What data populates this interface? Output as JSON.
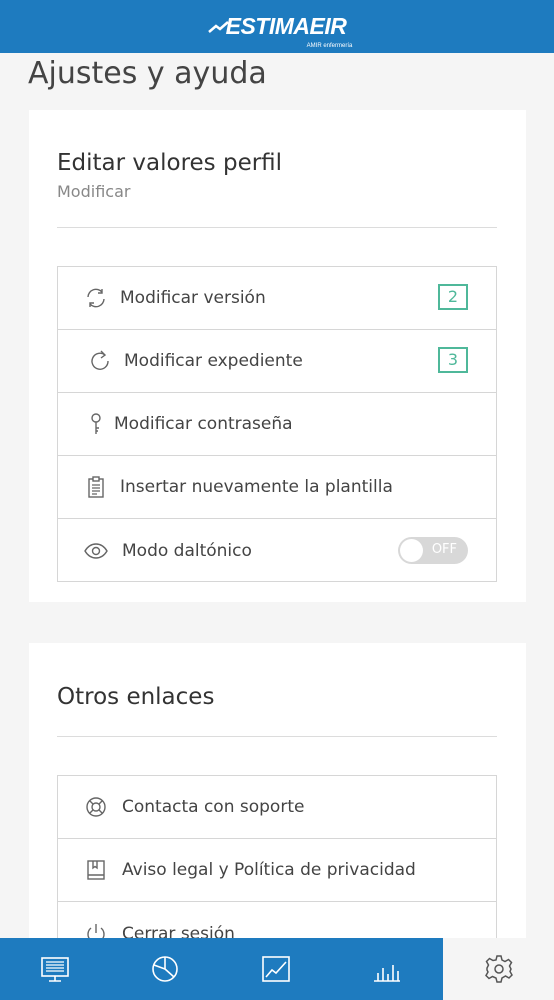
{
  "header": {
    "logo_text": "ESTIMAEIR",
    "logo_sub": "AMIR enfermería"
  },
  "page_title": "Ajustes y ayuda",
  "profile_card": {
    "title": "Editar valores perfil",
    "subtitle": "Modificar",
    "items": [
      {
        "label": "Modificar versión",
        "icon": "refresh-icon",
        "badge": "2"
      },
      {
        "label": "Modificar expediente",
        "icon": "redo-icon",
        "badge": "3"
      },
      {
        "label": "Modificar contraseña",
        "icon": "key-icon"
      },
      {
        "label": "Insertar nuevamente la plantilla",
        "icon": "clipboard-icon"
      },
      {
        "label": "Modo daltónico",
        "icon": "eye-icon",
        "toggle": "OFF"
      }
    ]
  },
  "links_card": {
    "title": "Otros enlaces",
    "items": [
      {
        "label": "Contacta con soporte",
        "icon": "lifebuoy-icon"
      },
      {
        "label": "Aviso legal y Política de privacidad",
        "icon": "book-icon"
      },
      {
        "label": "Cerrar sesión",
        "icon": "power-icon"
      }
    ]
  },
  "bottom_nav": {
    "items": [
      {
        "icon": "presentation-icon"
      },
      {
        "icon": "pie-chart-icon"
      },
      {
        "icon": "line-chart-icon"
      },
      {
        "icon": "bar-chart-icon"
      },
      {
        "icon": "gear-icon",
        "active": true
      }
    ]
  },
  "colors": {
    "primary": "#1e7bbf",
    "accent": "#4fb89a",
    "background": "#f5f5f5"
  }
}
